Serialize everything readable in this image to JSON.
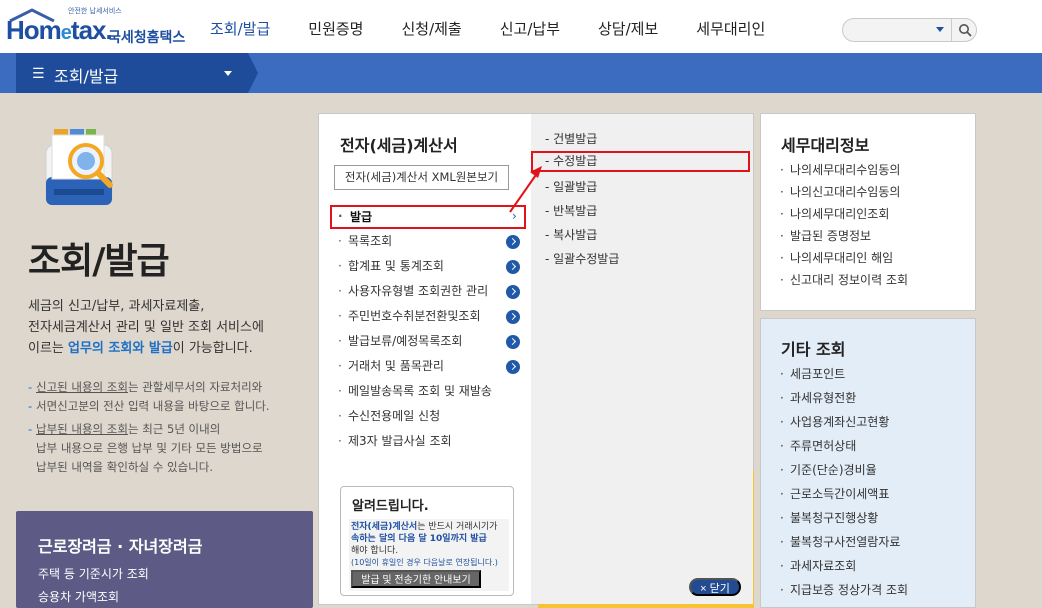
{
  "header": {
    "logo_small": "안전한 납세서비스",
    "logo_main": "Hom",
    "logo_e": "e",
    "logo_tax": "tax.",
    "logo_kr": "국세청홈택스",
    "nav": [
      "조회/발급",
      "민원증명",
      "신청/제출",
      "신고/납부",
      "상담/제보",
      "세무대리인"
    ],
    "search_placeholder": ""
  },
  "breadcrumb": {
    "menu_glyph": "☰",
    "label": "조회/발급"
  },
  "intro": {
    "title": "조회/발급",
    "desc_line1": "세금의 신고/납부, 과세자료제출,",
    "desc_line2": "전자세금계산서 관리 및 일반 조회 서비스에",
    "desc_line3_pre": "이르는 ",
    "desc_line3_hl": "업무의 조회와 발급",
    "desc_line3_post": "이 가능합니다.",
    "note1_u": "신고된 내용의 조회",
    "note1_rest": "는 관할세무서의 자료처리와",
    "note1_line2": "서면신고분의 전산 입력 내용을 바탕으로 합니다.",
    "note2_u": "납부된 내용의 조회",
    "note2_rest": "는 최근 5년 이내의",
    "note2_line2": "납부 내용으로 은행 납부 및 기타 모든 방법으로",
    "note2_line3": "납부된 내역을 확인하실 수 있습니다."
  },
  "purple_box": {
    "title": "근로장려금 · 자녀장려금",
    "items": [
      "주택 등 기준시가 조회",
      "승용차 가액조회"
    ]
  },
  "panel": {
    "title": "전자(세금)계산서",
    "xml_button": "전자(세금)계산서 XML원본보기",
    "menu": [
      "발급",
      "목록조회",
      "합계표 및 통계조회",
      "사용자유형별 조회권한 관리",
      "주민번호수취분전환및조회",
      "발급보류/예정목록조회",
      "거래처 및 품목관리",
      "메일발송목록 조회 및 재발송",
      "수신전용메일 신청",
      "제3자 발급사실 조회"
    ],
    "selected_chevron": "›",
    "submenu": [
      "- 건별발급",
      "- 수정발급",
      "- 일괄발급",
      "- 반복발급",
      "- 복사발급",
      "- 일괄수정발급"
    ],
    "notice": {
      "title": "알려드립니다.",
      "l1_blue": "전자(세금)계산서",
      "l1_rest": "는 반드시 거래시기가",
      "l2_blue": "속하는 달의 다음 달 10일까지 발급",
      "l3": "해야 합니다.",
      "l4": "(10일이 휴일인 경우 다음날로 연장됩니다.)",
      "button": "발급 및 전송기한 안내보기"
    },
    "close": "× 닫기"
  },
  "right": {
    "box1_title": "세무대리정보",
    "box1_items": [
      "나의세무대리수임동의",
      "나의신고대리수임동의",
      "나의세무대리인조회",
      "발급된 증명정보",
      "나의세무대리인 해임",
      "신고대리 정보이력 조회"
    ],
    "box2_title": "기타 조회",
    "box2_items": [
      "세금포인트",
      "과세유형전환",
      "사업용계좌신고현황",
      "주류면허상태",
      "기준(단순)경비율",
      "근로소득간이세액표",
      "불복청구진행상황",
      "불복청구사전열람자료",
      "과세자료조회",
      "지급보증 정상가격 조회"
    ]
  }
}
